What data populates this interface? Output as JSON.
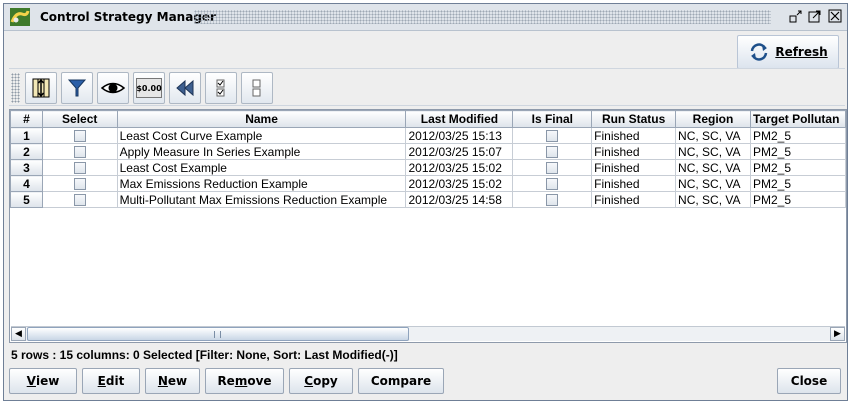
{
  "window": {
    "title": "Control Strategy Manager"
  },
  "top": {
    "refresh_label": "Refresh"
  },
  "toolbar": {
    "tools": [
      {
        "icon": "column-sort-icon"
      },
      {
        "icon": "filter-icon"
      },
      {
        "icon": "eye-icon",
        "label": ""
      },
      {
        "icon": "money-icon",
        "label": "$0.00"
      },
      {
        "icon": "rewind-icon"
      },
      {
        "icon": "select-all-icon"
      },
      {
        "icon": "clear-selection-icon"
      }
    ]
  },
  "table": {
    "columns": [
      "#",
      "Select",
      "Name",
      "Last Modified",
      "Is Final",
      "Run Status",
      "Region",
      "Target Pollutan"
    ],
    "rows": [
      {
        "num": "1",
        "name": "Least Cost Curve Example",
        "modified": "2012/03/25 15:13",
        "status": "Finished",
        "region": "NC, SC, VA",
        "pollutant": "PM2_5"
      },
      {
        "num": "2",
        "name": "Apply Measure In Series Example",
        "modified": "2012/03/25 15:07",
        "status": "Finished",
        "region": "NC, SC, VA",
        "pollutant": "PM2_5"
      },
      {
        "num": "3",
        "name": "Least Cost Example",
        "modified": "2012/03/25 15:02",
        "status": "Finished",
        "region": "NC, SC, VA",
        "pollutant": "PM2_5"
      },
      {
        "num": "4",
        "name": "Max Emissions Reduction Example",
        "modified": "2012/03/25 15:02",
        "status": "Finished",
        "region": "NC, SC, VA",
        "pollutant": "PM2_5"
      },
      {
        "num": "5",
        "name": "Multi-Pollutant Max Emissions Reduction Example",
        "modified": "2012/03/25 14:58",
        "status": "Finished",
        "region": "NC, SC, VA",
        "pollutant": "PM2_5"
      }
    ]
  },
  "status_text": "5 rows : 15 columns: 0 Selected [Filter: None, Sort: Last Modified(-)]",
  "buttons": {
    "view": {
      "mn": "V",
      "rest": "iew"
    },
    "edit": {
      "mn": "E",
      "rest": "dit"
    },
    "new": {
      "mn": "N",
      "rest": "ew"
    },
    "remove": {
      "pre": "Re",
      "mn": "m",
      "rest": "ove"
    },
    "copy": {
      "mn": "C",
      "rest": "opy"
    },
    "compare": "Compare",
    "close": "Close"
  },
  "colors": {
    "title_bg": "#dfe4ea",
    "header_bg": "#dde3ea",
    "border": "#9aa6b6"
  }
}
